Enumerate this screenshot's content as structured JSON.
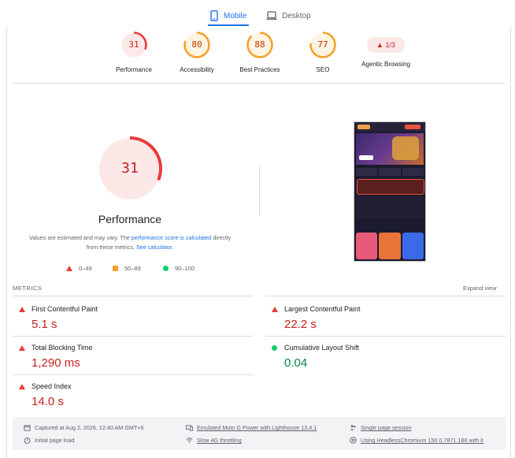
{
  "tabs": {
    "mobile": "Mobile",
    "desktop": "Desktop"
  },
  "categories": [
    {
      "score": "31",
      "label": "Performance",
      "fraction": 0.31,
      "color": "#eb3a3a",
      "bg": "#fde8e8"
    },
    {
      "score": "80",
      "label": "Accessibility",
      "fraction": 0.8,
      "color": "#f4a22d",
      "bg": "#fff4e2"
    },
    {
      "score": "88",
      "label": "Best Practices",
      "fraction": 0.88,
      "color": "#f4a22d",
      "bg": "#fff4e2"
    },
    {
      "score": "77",
      "label": "SEO",
      "fraction": 0.77,
      "color": "#f4a22d",
      "bg": "#fff4e2"
    }
  ],
  "agentic": {
    "badge": "1/3",
    "label": "Agentic Browsing"
  },
  "performance": {
    "score": "31",
    "fraction": 0.31,
    "title": "Performance",
    "note_a": "Values are estimated and may vary. The ",
    "note_link1": "performance score is calculated",
    "note_b": " directly from these metrics. ",
    "note_link2": "See calculator."
  },
  "legend": {
    "bad": "0–49",
    "avg": "50–89",
    "good": "90–100"
  },
  "metrics_header": "METRICS",
  "expand_label": "Expand view",
  "metrics": [
    {
      "label": "First Contentful Paint",
      "value": "5.1 s",
      "status": "bad"
    },
    {
      "label": "Largest Contentful Paint",
      "value": "22.2 s",
      "status": "bad"
    },
    {
      "label": "Total Blocking Time",
      "value": "1,290 ms",
      "status": "bad"
    },
    {
      "label": "Cumulative Layout Shift",
      "value": "0.04",
      "status": "good"
    },
    {
      "label": "Speed Index",
      "value": "14.0 s",
      "status": "bad"
    }
  ],
  "footer": {
    "captured": "Captured at Aug 2, 2026, 12:40 AM GMT+6",
    "load": "Initial page load",
    "device": "Emulated Moto G Power with Lighthouse 13.4.1",
    "throttle": "Slow 4G throttling",
    "session": "Single page session",
    "browser": "Using HeadlessChromium 150.0.7871.186 with lr"
  }
}
